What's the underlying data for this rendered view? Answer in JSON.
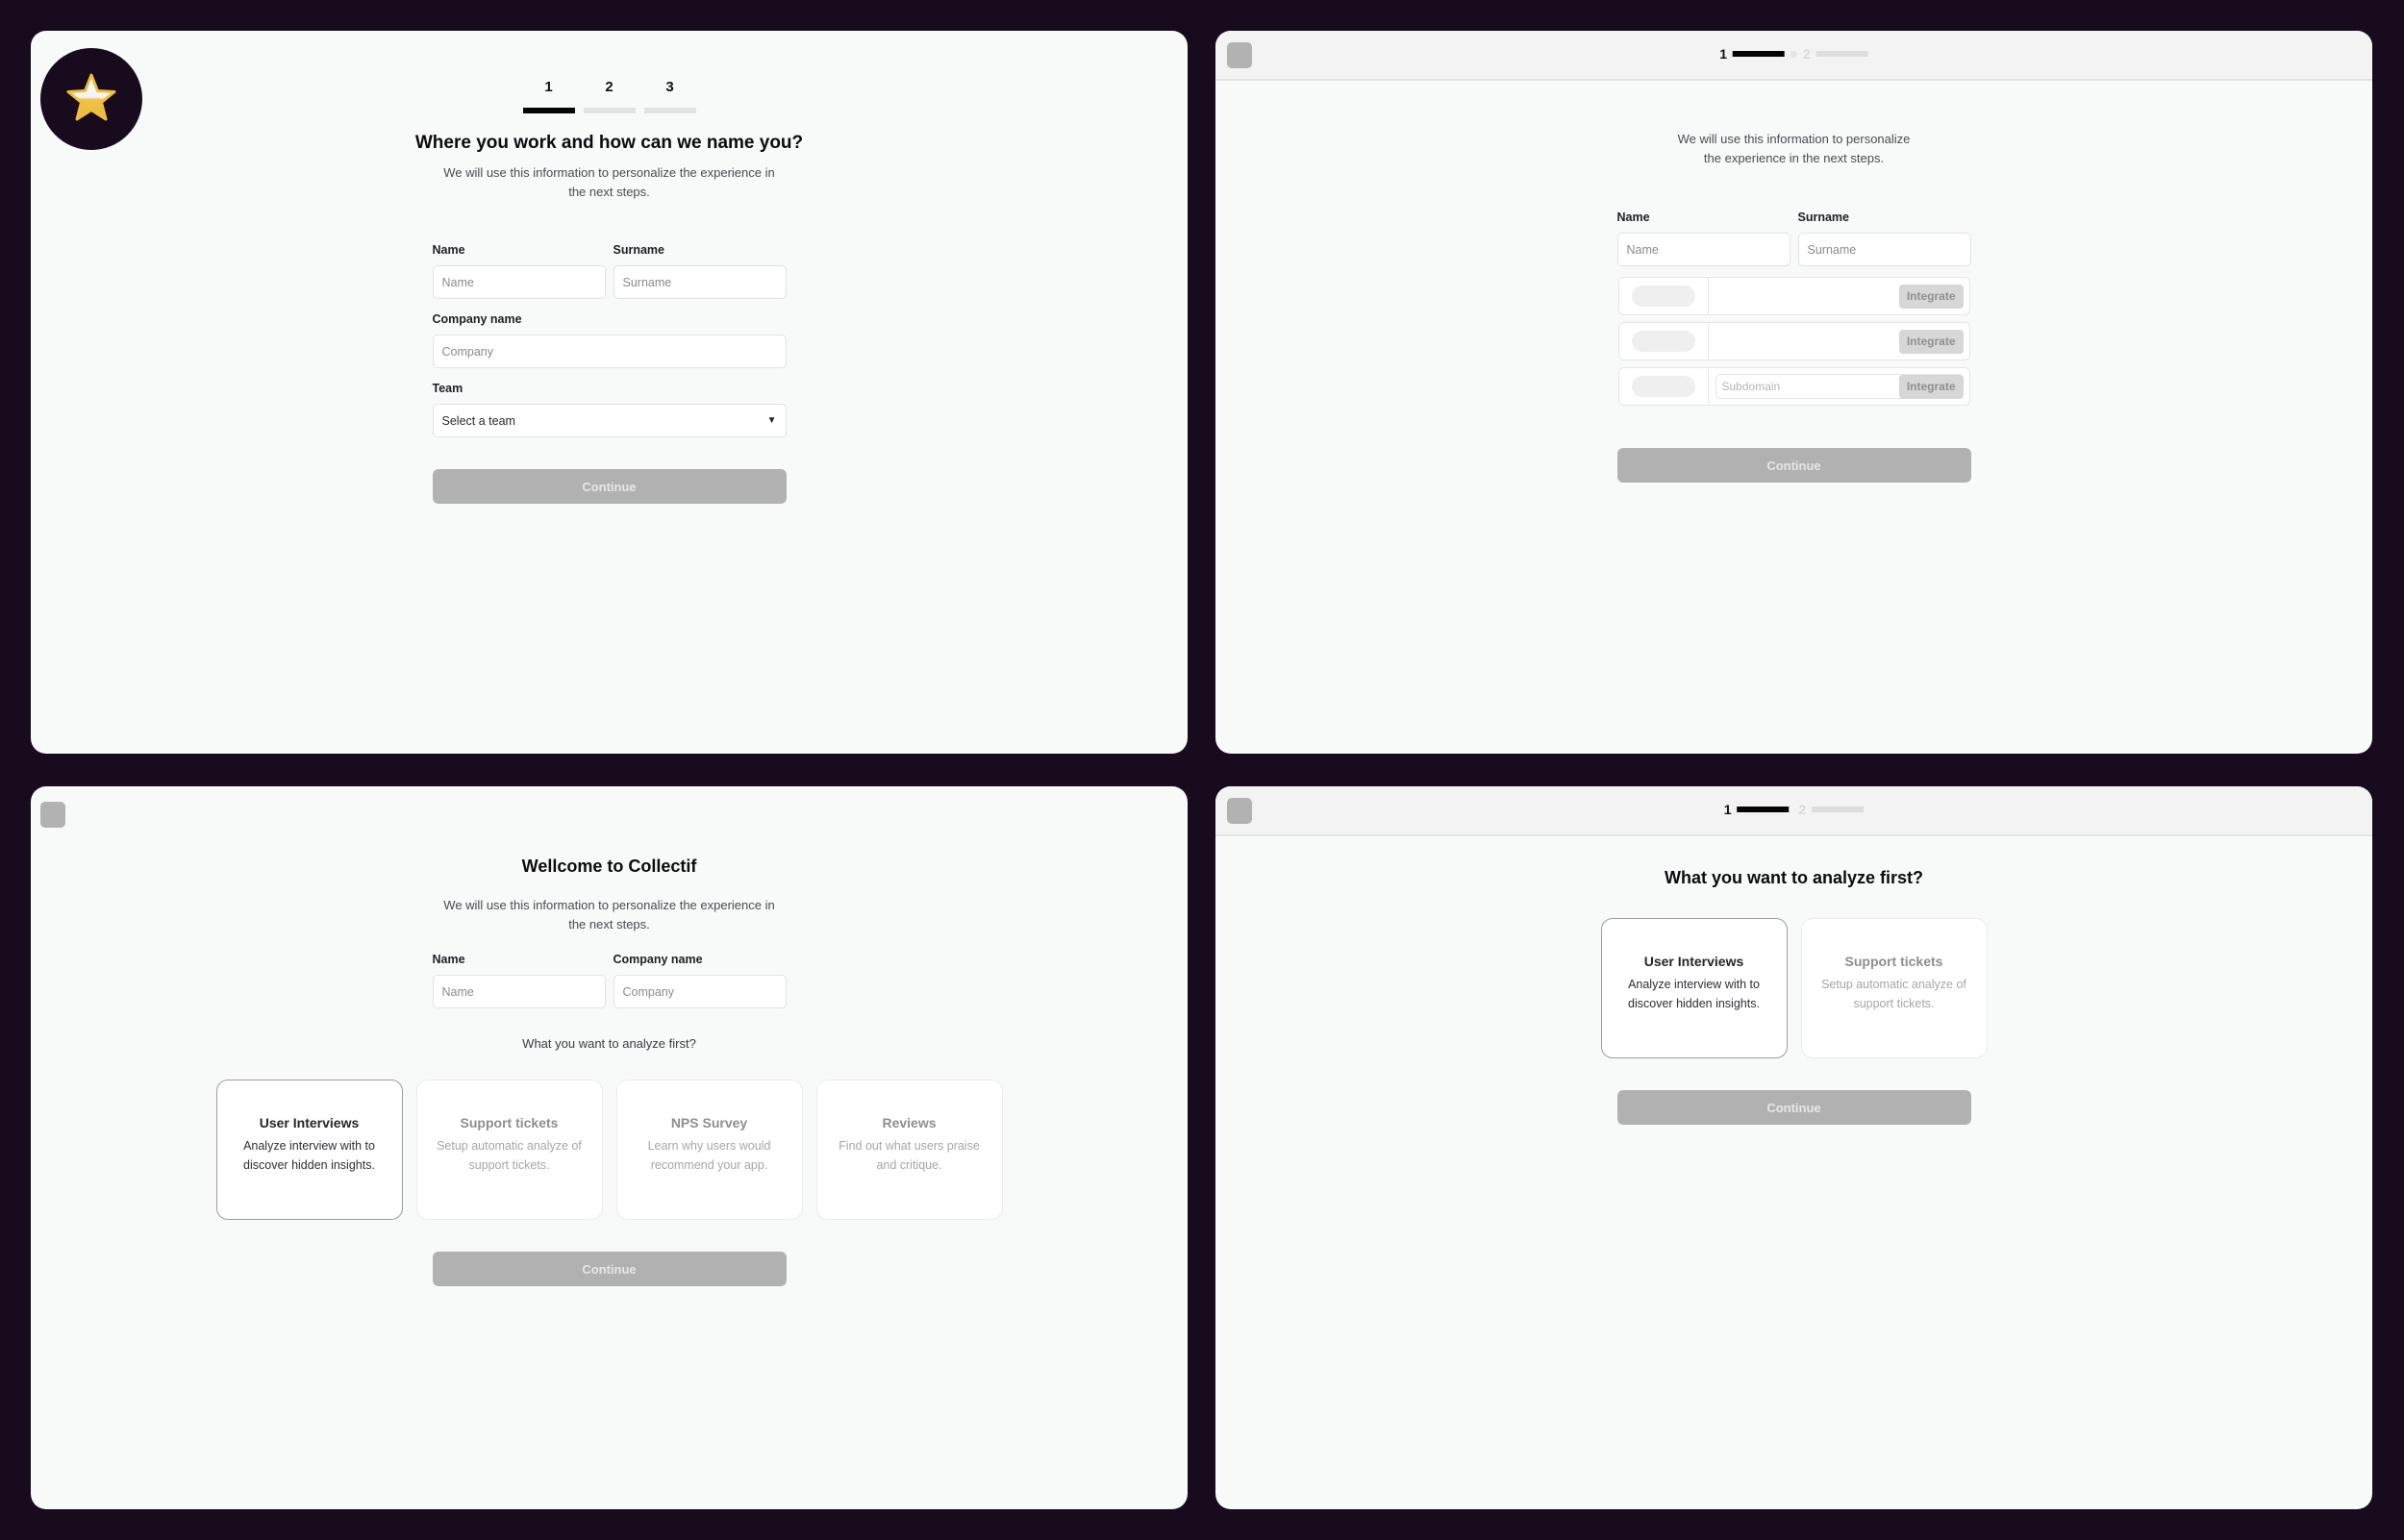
{
  "screen1": {
    "logo_icon": "star-icon",
    "steps": [
      {
        "label": "1",
        "active": true
      },
      {
        "label": "2",
        "active": false
      },
      {
        "label": "3",
        "active": false
      }
    ],
    "title": "Where you work and how can we name you?",
    "subtitle_line1": "We will use this information to personalize the experience in",
    "subtitle_line2": "the next steps.",
    "fields": {
      "name_label": "Name",
      "name_placeholder": "Name",
      "surname_label": "Surname",
      "surname_placeholder": "Surname",
      "company_label": "Company name",
      "company_placeholder": "Company",
      "team_label": "Team",
      "team_value": "Select a team",
      "team_caret": "▼"
    },
    "continue_label": "Continue"
  },
  "screen2": {
    "steps": [
      {
        "label": "1",
        "active": true
      },
      {
        "label": "2",
        "active": false
      }
    ],
    "subtitle_line1": "We will use this information to personalize",
    "subtitle_line2": "the experience in the next steps.",
    "fields": {
      "name_label": "Name",
      "name_placeholder": "Name",
      "surname_label": "Surname",
      "surname_placeholder": "Surname"
    },
    "integrations": [
      {
        "button": "Integrate",
        "input_placeholder": ""
      },
      {
        "button": "Integrate",
        "input_placeholder": ""
      },
      {
        "button": "Integrate",
        "input_placeholder": "Subdomain"
      }
    ],
    "continue_label": "Continue"
  },
  "screen3": {
    "title": "Wellcome to Collectif",
    "subtitle_line1": "We will use this information to personalize the experience in",
    "subtitle_line2": "the next steps.",
    "fields": {
      "name_label": "Name",
      "name_placeholder": "Name",
      "company_label": "Company name",
      "company_placeholder": "Company"
    },
    "question": "What you want to analyze first?",
    "cards": [
      {
        "title": "User Interviews",
        "line1": "Analyze interview with to",
        "line2": "discover hidden insights.",
        "selected": true
      },
      {
        "title": "Support tickets",
        "line1": "Setup automatic analyze of",
        "line2": "support tickets.",
        "selected": false
      },
      {
        "title": "NPS Survey",
        "line1": "Learn why users would",
        "line2": "recommend your app.",
        "selected": false
      },
      {
        "title": "Reviews",
        "line1": "Find out what users praise",
        "line2": "and critique.",
        "selected": false
      }
    ],
    "continue_label": "Continue"
  },
  "screen4": {
    "steps": [
      {
        "label": "1",
        "active": true
      },
      {
        "label": "2",
        "active": false
      }
    ],
    "title": "What you want to analyze first?",
    "cards": [
      {
        "title": "User Interviews",
        "line1": "Analyze interview with to",
        "line2": "discover hidden insights.",
        "selected": true
      },
      {
        "title": "Support tickets",
        "line1": "Setup automatic analyze of",
        "line2": "support tickets.",
        "selected": false
      }
    ],
    "continue_label": "Continue"
  }
}
